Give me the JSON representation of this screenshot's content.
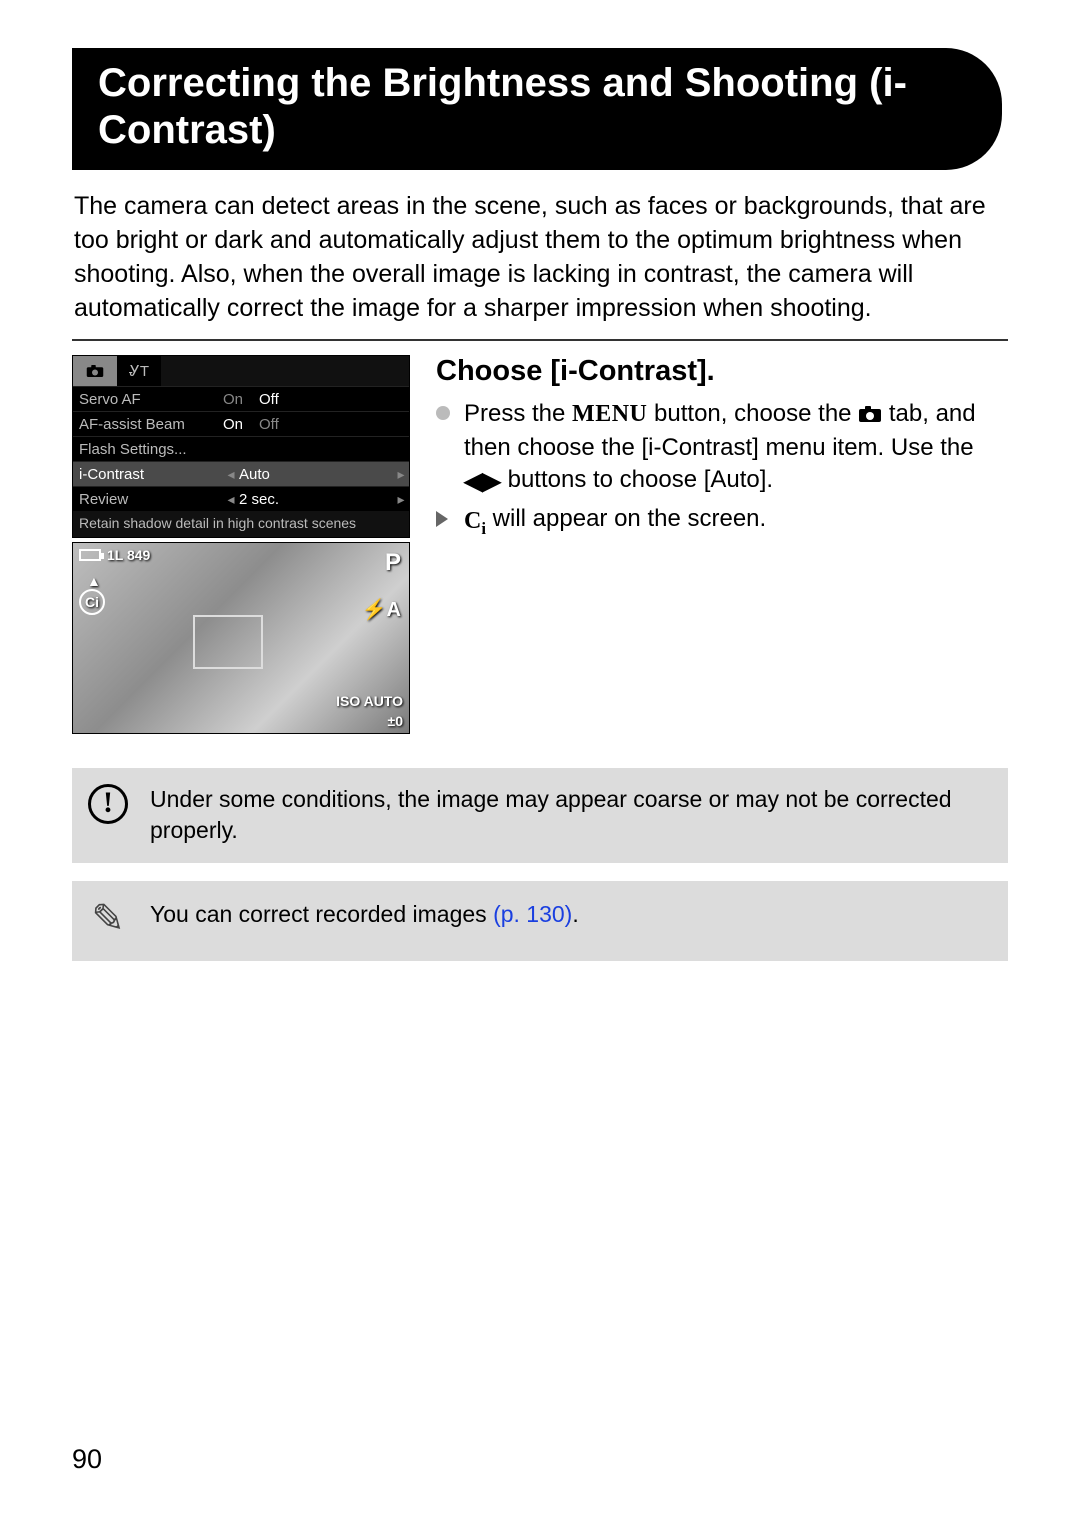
{
  "title": "Correcting the Brightness and Shooting (i-Contrast)",
  "intro": "The camera can detect areas in the scene, such as faces or backgrounds, that are too bright or dark and automatically adjust them to the optimum brightness when shooting. Also, when the overall image is lacking in contrast, the camera will automatically correct the image for a sharper impression when shooting.",
  "menu": {
    "rows": [
      {
        "label": "Servo AF",
        "opt1": "On",
        "opt2": "Off",
        "active": "opt2"
      },
      {
        "label": "AF-assist Beam",
        "opt1": "On",
        "opt2": "Off",
        "active": "opt1"
      },
      {
        "label": "Flash Settings...",
        "opt1": "",
        "opt2": "",
        "active": ""
      },
      {
        "label": "i-Contrast",
        "opt1": "Auto",
        "opt2": "",
        "active": "opt1",
        "selected": true,
        "arrows": true
      },
      {
        "label": "Review",
        "opt1": "2 sec.",
        "opt2": "",
        "active": "opt1",
        "arrows": true
      }
    ],
    "hint": "Retain shadow detail in high contrast scenes"
  },
  "preview": {
    "shots": "1L 849",
    "mode": "P",
    "flash": "⚡A",
    "ci": "Ci",
    "iso": "ISO AUTO",
    "ev": "±0"
  },
  "step": {
    "title": "Choose [i-Contrast].",
    "bullet1_a": "Press the ",
    "bullet1_menu": "MENU",
    "bullet1_b": " button, choose the ",
    "bullet1_c": " tab, and then choose the [i-Contrast] menu item. Use the ",
    "bullet1_d": " buttons to choose [Auto].",
    "bullet2_a": " will appear on the screen."
  },
  "warn": "Under some conditions, the image may appear coarse or may not be corrected properly.",
  "note_a": "You can correct recorded images ",
  "note_link": "(p. 130)",
  "note_b": ".",
  "page_number": "90"
}
